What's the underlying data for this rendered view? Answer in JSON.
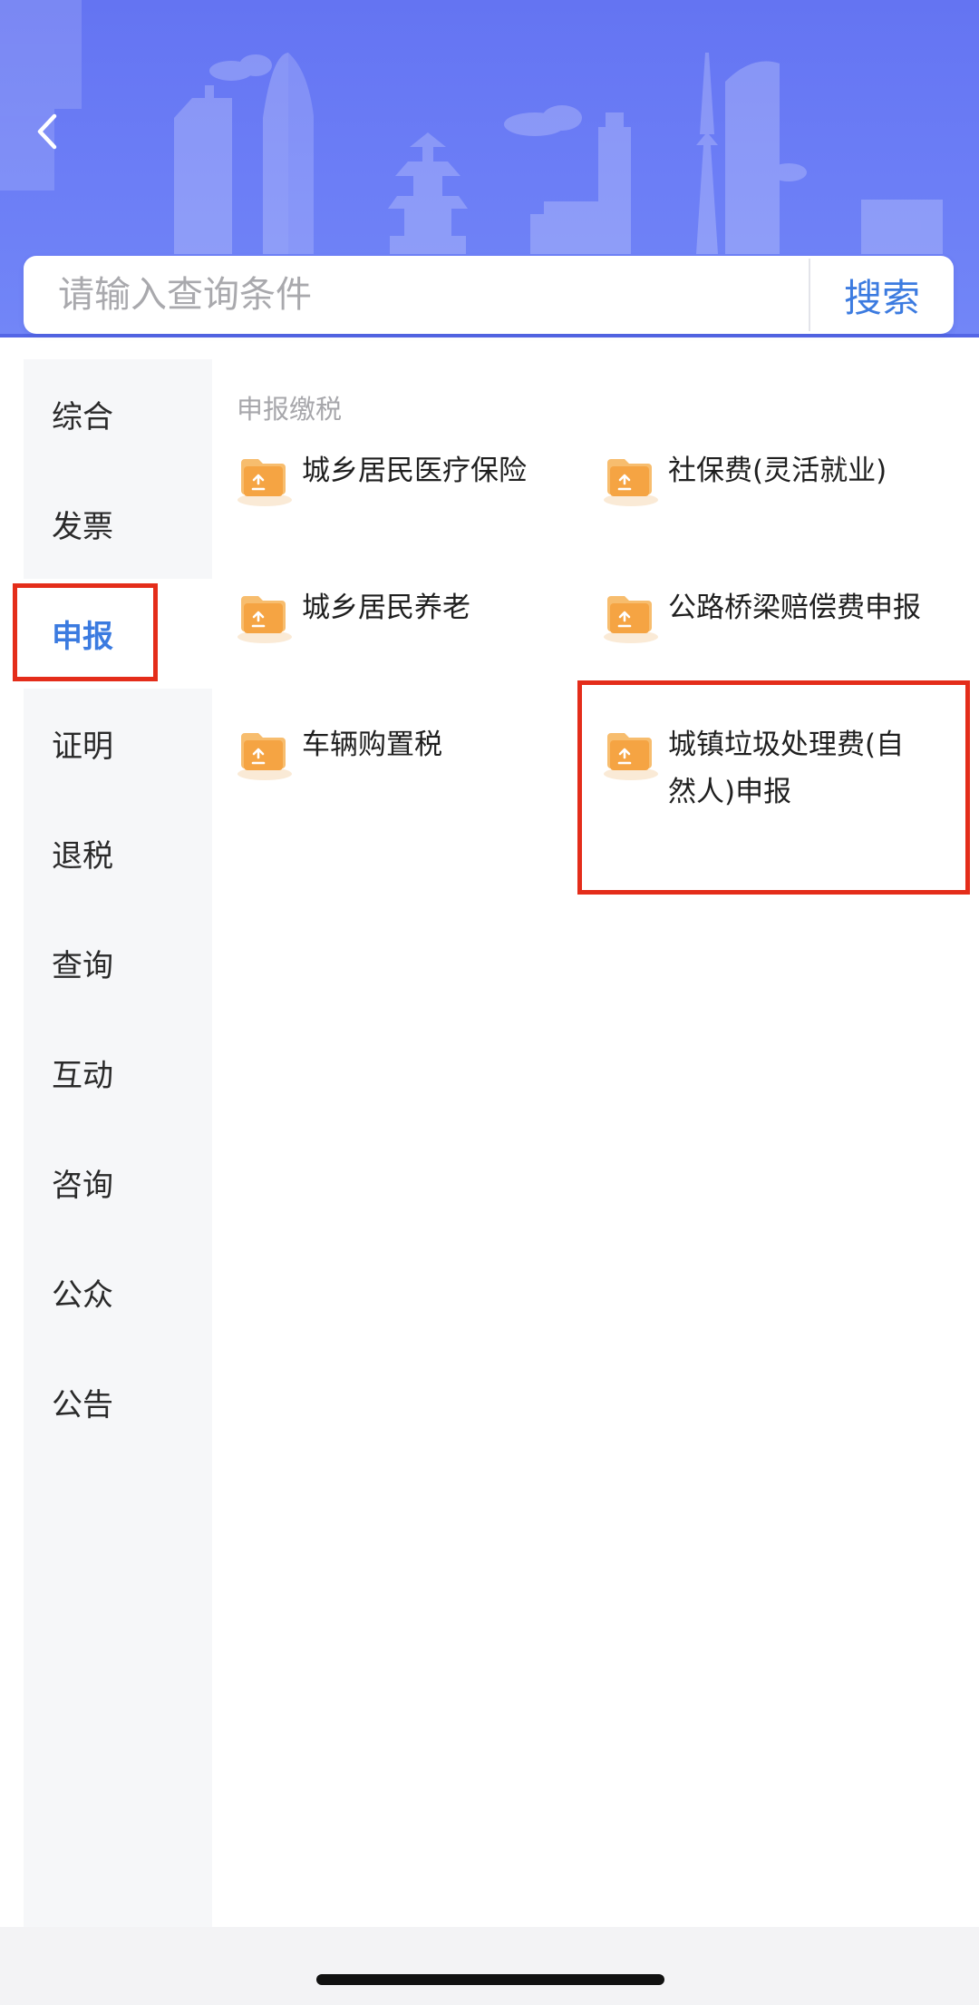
{
  "header": {
    "back_icon": "chevron-left-icon"
  },
  "search": {
    "placeholder": "请输入查询条件",
    "button_label": "搜索"
  },
  "sidebar": {
    "items": [
      {
        "label": "综合"
      },
      {
        "label": "发票"
      },
      {
        "label": "申报",
        "active": true
      },
      {
        "label": "证明"
      },
      {
        "label": "退税"
      },
      {
        "label": "查询"
      },
      {
        "label": "互动"
      },
      {
        "label": "咨询"
      },
      {
        "label": "公众"
      },
      {
        "label": "公告"
      }
    ]
  },
  "content": {
    "section_title": "申报缴税",
    "items": [
      {
        "label": "城乡居民医疗保险",
        "icon": "folder-upload-icon"
      },
      {
        "label": "社保费(灵活就业)",
        "icon": "folder-upload-icon"
      },
      {
        "label": "城乡居民养老",
        "icon": "folder-upload-icon"
      },
      {
        "label": "公路桥梁赔偿费申报",
        "icon": "folder-upload-icon"
      },
      {
        "label": "车辆购置税",
        "icon": "folder-upload-icon"
      },
      {
        "label": "城镇垃圾处理费(自然人)申报",
        "icon": "folder-upload-icon"
      }
    ]
  },
  "colors": {
    "header": "#6a7cf5",
    "accent": "#3b7be0",
    "highlight": "#e42d1a",
    "icon": "#f4a84a"
  }
}
